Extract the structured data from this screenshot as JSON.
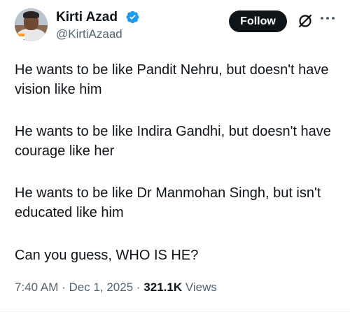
{
  "author": {
    "name": "Kirti Azad",
    "handle": "@KirtiAzaad",
    "verified": true,
    "avatar_icon": "profile-photo-with-indian-flag"
  },
  "actions": {
    "follow_label": "Follow",
    "grok_icon": "grok-slash-circle-icon",
    "more_icon": "more-dots-icon"
  },
  "tweet": {
    "paragraphs": [
      "He wants to be like Pandit Nehru, but doesn't have vision like him",
      "He wants to be like Indira Gandhi, but doesn't have courage like her",
      "He wants to be like Dr Manmohan Singh, but isn't educated like him",
      "Can you guess, WHO IS HE?"
    ]
  },
  "meta": {
    "time": "7:40 AM",
    "separator": " · ",
    "date": "Dec 1, 2025",
    "views_count": "321.1K",
    "views_label": "Views"
  },
  "colors": {
    "verified_badge": "#1d9bf0",
    "text_primary": "#0f1419",
    "text_secondary": "#536471",
    "follow_bg": "#0f1419"
  }
}
